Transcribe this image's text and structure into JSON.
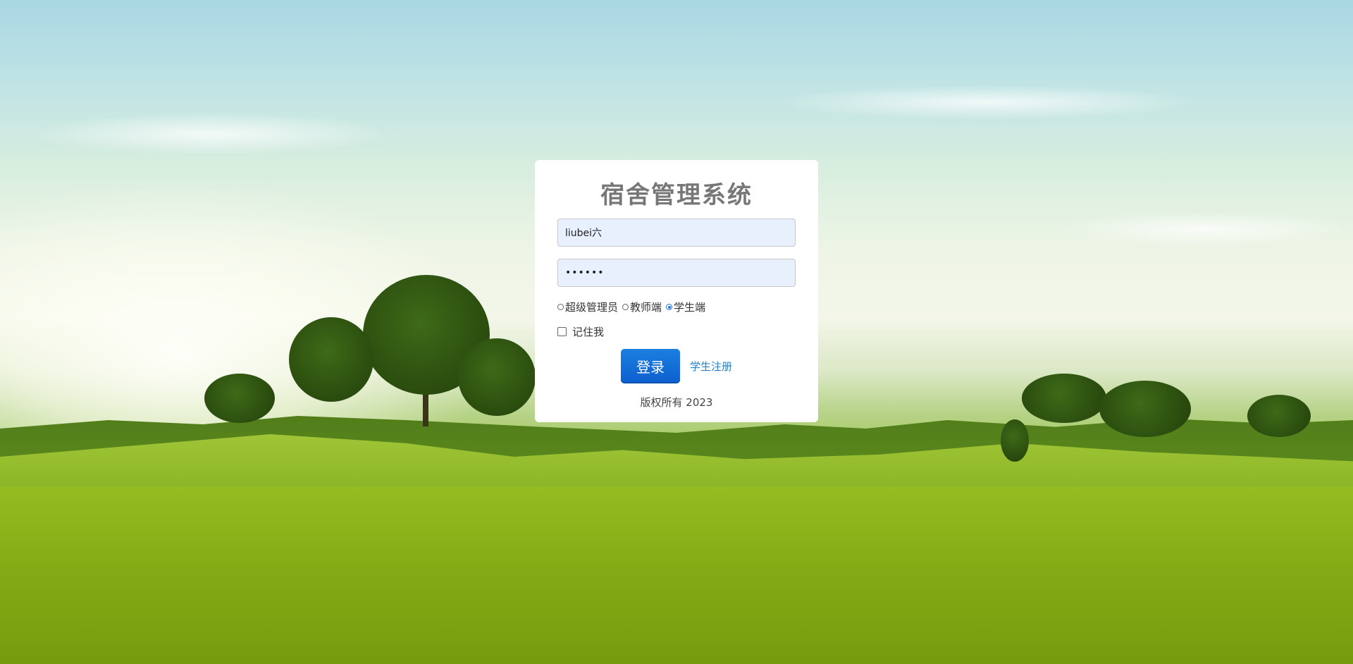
{
  "app": {
    "title": "宿舍管理系统"
  },
  "login": {
    "username_value": "liubei六",
    "password_value": "••••••",
    "roles": [
      {
        "label": "超级管理员",
        "checked": false
      },
      {
        "label": "教师端",
        "checked": false
      },
      {
        "label": "学生端",
        "checked": true
      }
    ],
    "remember_label": "记住我",
    "submit_label": "登录",
    "register_link": "学生注册",
    "copyright": "版权所有 2023"
  },
  "colors": {
    "button": "#0d5fcf",
    "link": "#2a7fc6",
    "title": "#777777",
    "input_bg": "#e8f0fe"
  }
}
